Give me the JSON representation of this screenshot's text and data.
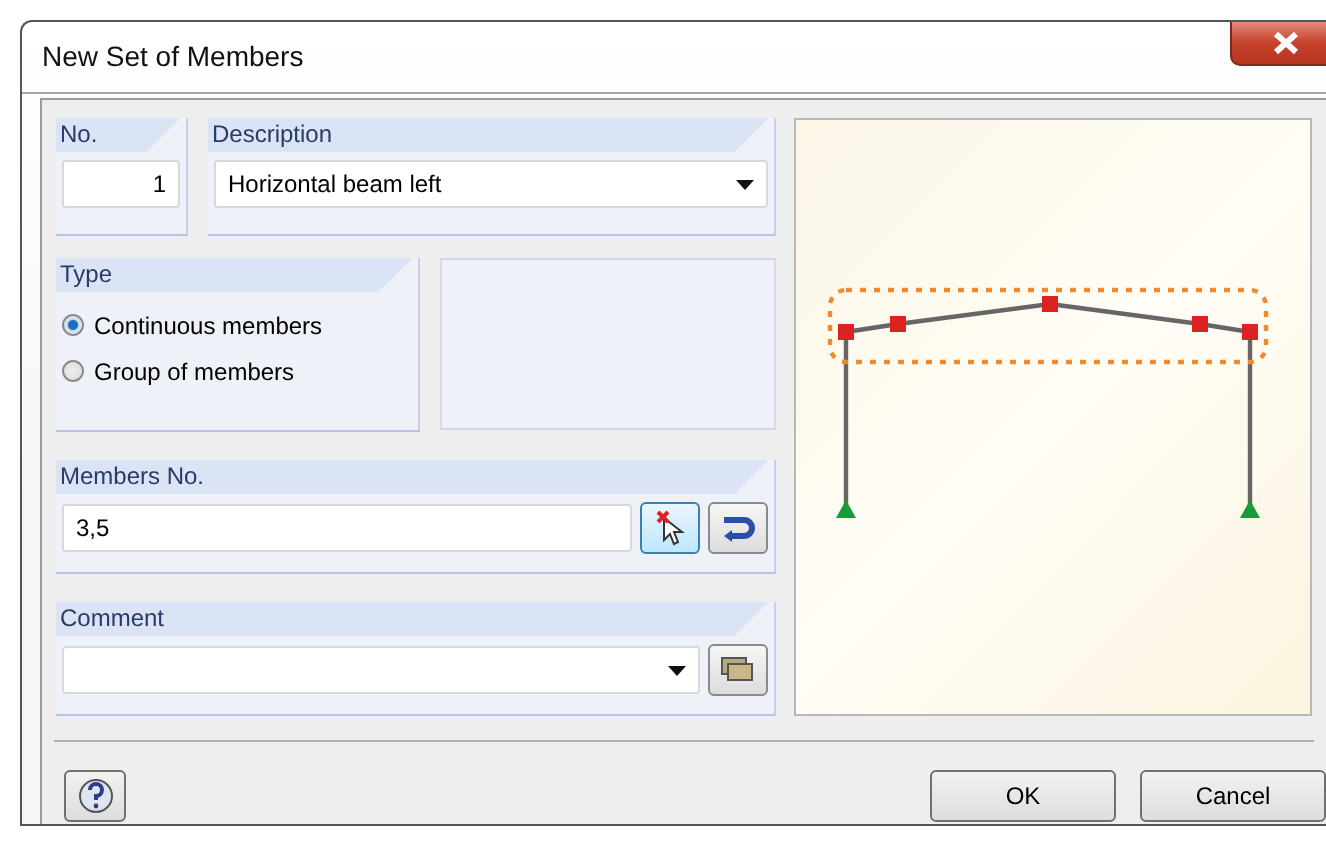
{
  "window": {
    "title": "New Set of Members"
  },
  "number": {
    "label": "No.",
    "value": "1"
  },
  "description": {
    "label": "Description",
    "value": "Horizontal beam left"
  },
  "type": {
    "label": "Type",
    "options": [
      {
        "label": "Continuous members",
        "selected": true
      },
      {
        "label": "Group of members",
        "selected": false
      }
    ]
  },
  "members": {
    "label": "Members No.",
    "value": "3,5"
  },
  "comment": {
    "label": "Comment"
  },
  "buttons": [
    "OK",
    "Cancel"
  ]
}
